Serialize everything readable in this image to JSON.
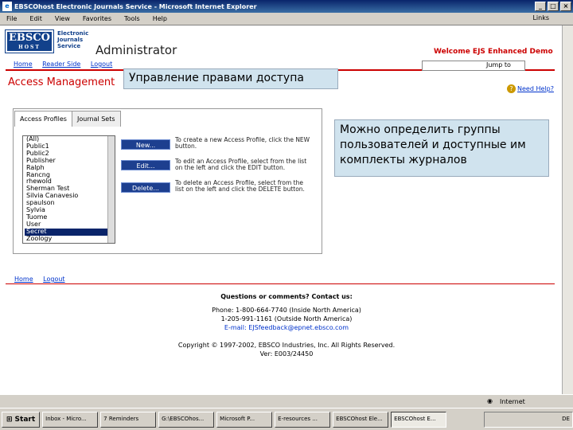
{
  "window": {
    "title": "EBSCOhost Electronic Journals Service - Microsoft Internet Explorer",
    "links_label": "Links"
  },
  "menu": [
    "File",
    "Edit",
    "View",
    "Favorites",
    "Tools",
    "Help"
  ],
  "header": {
    "logo_main": "EBSCO",
    "logo_sub": "HOST",
    "logo_text": [
      "Electronic",
      "Journals",
      "Service"
    ],
    "title": "Administrator",
    "welcome": "Welcome EJS Enhanced Demo",
    "jump_value": "Jump to"
  },
  "nav": [
    "Home",
    "Reader Side",
    "Logout"
  ],
  "page": {
    "title": "Access Management",
    "help": "Need Help?"
  },
  "overlays": {
    "title_ru": "Управление правами доступа",
    "groups_ru": "Можно определить группы пользователей и доступные им комплекты журналов"
  },
  "tabs": [
    "Access Profiles",
    "Journal Sets"
  ],
  "profiles": [
    "(All)",
    "Public1",
    "Public2",
    "Publisher",
    "Ralph",
    "Rancng",
    "rhewold",
    "Sherman Test",
    "Silvia Canavesio",
    "spaulson",
    "Sylvia",
    "Tuome",
    "User",
    "Secret",
    "Zoology"
  ],
  "selected_index": 13,
  "actions": [
    {
      "label": "New...",
      "desc": "To create a new Access Profile, click the NEW button."
    },
    {
      "label": "Edit...",
      "desc": "To edit an Access Profile, select from the list on the left and click the EDIT button."
    },
    {
      "label": "Delete...",
      "desc": "To delete an Access Profile, select from the list on the left and click the DELETE button."
    }
  ],
  "footer": {
    "links": [
      "Home",
      "Logout"
    ],
    "heading": "Questions or comments? Contact us:",
    "phone1": "Phone: 1-800-664-7740 (Inside North America)",
    "phone2": "1-205-991-1161 (Outside North America)",
    "email": "E-mail: EJSfeedback@epnet.ebsco.com",
    "copyright": "Copyright © 1997-2002, EBSCO Industries, Inc. All Rights Reserved.",
    "version": "Ver: E003/24450"
  },
  "status": "Internet",
  "taskbar": {
    "start": "Start",
    "items": [
      "Inbox - Micro...",
      "7 Reminders",
      "G:\\EBSCOhos...",
      "Microsoft P...",
      "E-resources ...",
      "EBSCOhost Ele...",
      "EBSCOhost E..."
    ],
    "active_index": 6,
    "lang": "DE"
  }
}
